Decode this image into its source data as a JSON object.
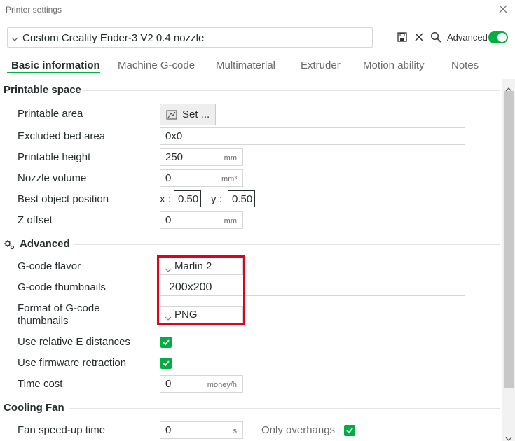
{
  "window": {
    "title": "Printer settings",
    "close_icon": "close-icon"
  },
  "preset": {
    "value": "Custom Creality Ender-3 V2 0.4 nozzle"
  },
  "toolbar": {
    "icons": [
      "save-icon",
      "delete-icon",
      "search-icon"
    ],
    "advanced_label": "Advanced",
    "advanced_enabled": true
  },
  "tabs": [
    {
      "label": "Basic information",
      "active": true
    },
    {
      "label": "Machine G-code",
      "active": false
    },
    {
      "label": "Multimaterial",
      "active": false
    },
    {
      "label": "Extruder",
      "active": false
    },
    {
      "label": "Motion ability",
      "active": false
    },
    {
      "label": "Notes",
      "active": false
    }
  ],
  "printable_space": {
    "title": "Printable space",
    "printable_area": {
      "label": "Printable area",
      "button": "Set ..."
    },
    "excluded_bed_area": {
      "label": "Excluded bed area",
      "value": "0x0"
    },
    "printable_height": {
      "label": "Printable height",
      "value": "250",
      "unit": "mm"
    },
    "nozzle_volume": {
      "label": "Nozzle volume",
      "value": "0",
      "unit": "mm³"
    },
    "best_object_position": {
      "label": "Best object position",
      "x_label": "x :",
      "x": "0.50",
      "y_label": "y :",
      "y": "0.50"
    },
    "z_offset": {
      "label": "Z offset",
      "value": "0",
      "unit": "mm"
    }
  },
  "advanced": {
    "title": "Advanced",
    "gcode_flavor": {
      "label": "G-code flavor",
      "value": "Marlin 2"
    },
    "gcode_thumbnails": {
      "label": "G-code thumbnails",
      "value": "200x200"
    },
    "thumbnail_format": {
      "label_line1": "Format of G-code",
      "label_line2": "thumbnails",
      "value": "PNG"
    },
    "relative_e": {
      "label": "Use relative E distances",
      "checked": true
    },
    "firmware_retraction": {
      "label": "Use firmware retraction",
      "checked": true
    },
    "time_cost": {
      "label": "Time cost",
      "value": "0",
      "unit": "money/h"
    }
  },
  "cooling_fan": {
    "title": "Cooling Fan",
    "fan_speedup_time": {
      "label": "Fan speed-up time",
      "value": "0",
      "unit": "s"
    },
    "only_overhangs": {
      "label": "Only overhangs",
      "checked": true
    }
  },
  "colors": {
    "accent": "#00ae42",
    "highlight": "#e3001b",
    "text": "#262e30"
  }
}
